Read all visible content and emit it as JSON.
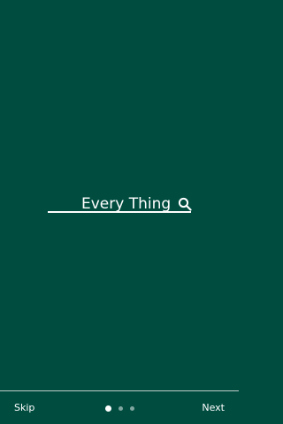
{
  "search": {
    "text": "Every Thing",
    "icon": "search-icon"
  },
  "footer": {
    "skip_label": "Skip",
    "next_label": "Next",
    "page_indicator": {
      "current_page": 1,
      "total_pages": 3
    }
  },
  "colors": {
    "background": "#004d40",
    "foreground": "#ffffff"
  }
}
